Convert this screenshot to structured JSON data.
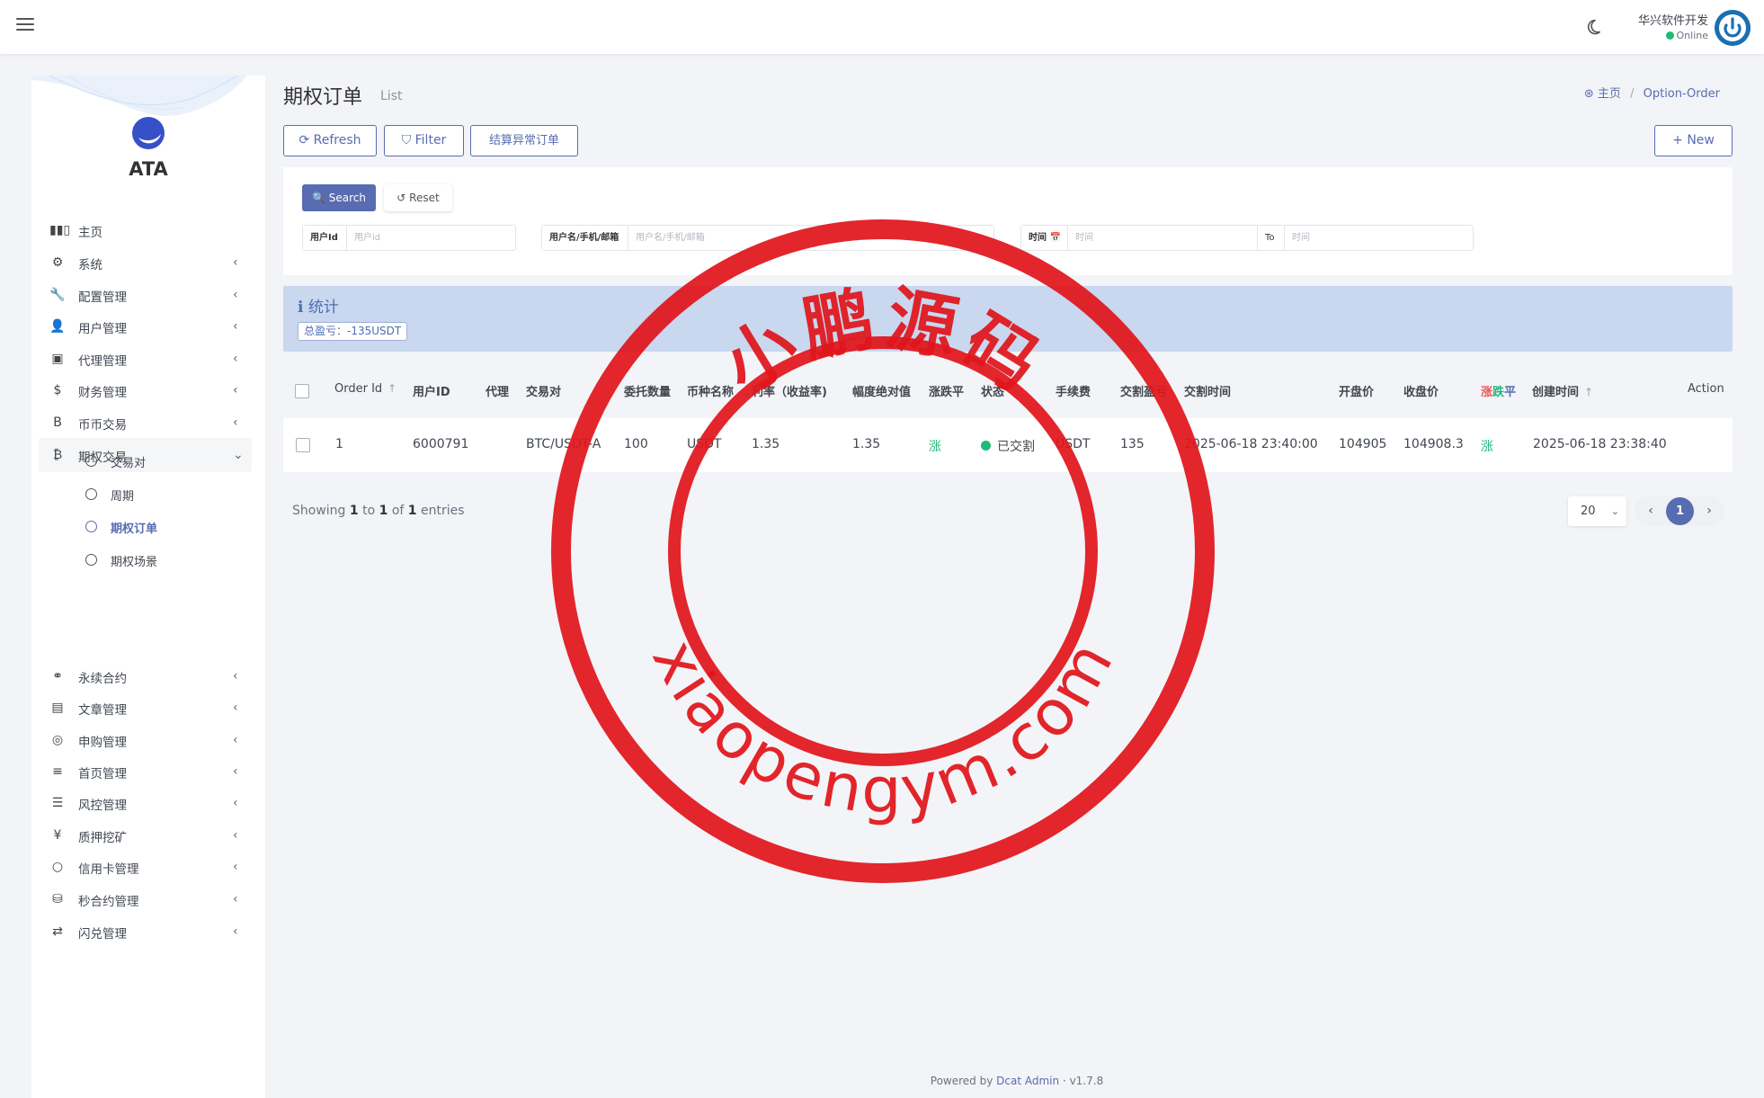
{
  "header": {
    "user_name": "华兴软件开发",
    "user_status": "Online"
  },
  "sidebar": {
    "brand": "ATA",
    "items": [
      {
        "label": "主页",
        "icon": "bar-chart-icon",
        "glyph": "▮▮▯"
      },
      {
        "label": "系统",
        "icon": "gear-icon",
        "glyph": "⚙"
      },
      {
        "label": "配置管理",
        "icon": "wrench-icon",
        "glyph": "🔧"
      },
      {
        "label": "用户管理",
        "icon": "user-icon",
        "glyph": "👤"
      },
      {
        "label": "代理管理",
        "icon": "id-card-icon",
        "glyph": "▣"
      },
      {
        "label": "财务管理",
        "icon": "dollar-icon",
        "glyph": "$"
      },
      {
        "label": "币币交易",
        "icon": "bitcoin-icon",
        "glyph": "B"
      },
      {
        "label": "期权交易",
        "icon": "bitcoin-icon",
        "glyph": "₿"
      },
      {
        "label": "永续合约",
        "icon": "link-icon",
        "glyph": "⚭"
      },
      {
        "label": "文章管理",
        "icon": "newspaper-icon",
        "glyph": "▤"
      },
      {
        "label": "申购管理",
        "icon": "lifebuoy-icon",
        "glyph": "◎"
      },
      {
        "label": "首页管理",
        "icon": "list-icon",
        "glyph": "≡"
      },
      {
        "label": "风控管理",
        "icon": "indent-icon",
        "glyph": "☰"
      },
      {
        "label": "质押挖矿",
        "icon": "yen-icon",
        "glyph": "¥"
      },
      {
        "label": "信用卡管理",
        "icon": "circle-icon",
        "glyph": "○"
      },
      {
        "label": "秒合约管理",
        "icon": "coins-icon",
        "glyph": "⛁"
      },
      {
        "label": "闪兑管理",
        "icon": "exchange-icon",
        "glyph": "⇄"
      }
    ],
    "sub_items": [
      {
        "label": "交易对"
      },
      {
        "label": "周期"
      },
      {
        "label": "期权订单"
      },
      {
        "label": "期权场景"
      }
    ]
  },
  "page": {
    "title": "期权订单",
    "subtitle": "List",
    "breadcrumb_home": "主页",
    "breadcrumb_sep": "/",
    "breadcrumb_current": "Option-Order"
  },
  "toolbar": {
    "refresh": "⟳  Refresh",
    "filter": "⛉  Filter",
    "settle": "结算异常订单",
    "new": "+  New"
  },
  "filter": {
    "search": "🔍  Search",
    "reset": "↺  Reset",
    "user_id_label": "用户Id",
    "user_id_placeholder": "用户id",
    "user_name_label": "用户名/手机/邮箱",
    "user_name_placeholder": "用户名/手机/邮箱",
    "time_label": "时间 📅",
    "time_placeholder": "时间",
    "to_label": "To",
    "to_placeholder": "时间"
  },
  "stats": {
    "title": "ℹ  统计",
    "total": "总盈亏：-135USDT"
  },
  "table": {
    "columns": [
      "Order Id",
      "用户ID",
      "代理",
      "交易对",
      "委托数量",
      "币种名称",
      "利率（收益率)",
      "幅度绝对值",
      "涨跌平",
      "状态",
      "手续费",
      "交割盈亏",
      "交割时间",
      "开盘价",
      "收盘价",
      "涨跌平",
      "创建时间",
      "Action"
    ],
    "col_zhang": "涨",
    "col_die": "跌",
    "col_ping": "平",
    "rows": [
      {
        "order_id": "1",
        "user_id": "6000791",
        "agent": "",
        "pair": "BTC/USDT-A",
        "qty": "100",
        "coin": "USDT",
        "rate": "1.35",
        "range": "1.35",
        "direction": "涨",
        "status": "已交割",
        "fee": "USDT",
        "pnl": "135",
        "settle_time": "2025-06-18 23:40:00",
        "open_price": "104905",
        "close_price": "104908.3",
        "result": "涨",
        "created_at": "2025-06-18 23:38:40"
      }
    ]
  },
  "pagination": {
    "showing_prefix": "Showing",
    "from": "1",
    "to_word": "to",
    "to": "1",
    "of_word": "of",
    "total": "1",
    "entries_word": "entries",
    "per_page": "20",
    "current_page": "1"
  },
  "footer": {
    "powered": "Powered by",
    "link": "Dcat Admin",
    "version": "·  v1.7.8"
  },
  "watermark": {
    "top_text": "小鹏源码",
    "bottom_text": "xiaopengym.com"
  },
  "colors": {
    "accent": "#586cb1",
    "rise": "#21b978",
    "fall": "#ea5455",
    "stamp": "#e0161c"
  }
}
